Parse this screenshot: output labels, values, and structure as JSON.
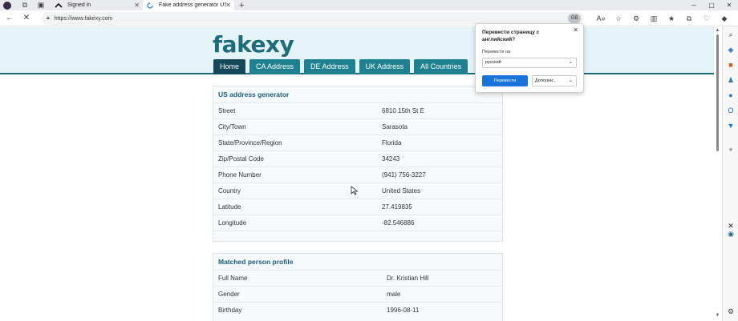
{
  "browser": {
    "tabs": [
      {
        "title": "Signed in",
        "active": false
      },
      {
        "title": "Fake address generator US - Ra",
        "active": true
      }
    ],
    "new_tab_label": "+",
    "url": "https://www.fakexy.com",
    "translate_badge": "GB",
    "icons": [
      "profile-icon",
      "workspaces-icon",
      "tab-actions-icon",
      "back-icon",
      "stop-icon",
      "read-aloud-icon",
      "favorite-icon",
      "extensions-icon",
      "split-screen-icon",
      "favorites-icon",
      "collections-icon",
      "browser-essentials-icon",
      "copilot-icon"
    ]
  },
  "page": {
    "logo": "fakexy",
    "nav": [
      "Home",
      "CA Address",
      "DE Address",
      "UK Address",
      "All Countries"
    ],
    "address_card": {
      "title": "US address generator",
      "rows": [
        {
          "k": "Street",
          "v": "6810 15th St E"
        },
        {
          "k": "City/Town",
          "v": "Sarasota"
        },
        {
          "k": "State/Province/Region",
          "v": "Florida"
        },
        {
          "k": "Zip/Postal Code",
          "v": "34243"
        },
        {
          "k": "Phone Number",
          "v": "(941) 756-3227"
        },
        {
          "k": "Country",
          "v": "United States"
        },
        {
          "k": "Latitude",
          "v": "27.419835"
        },
        {
          "k": "Longitude",
          "v": "-82.546886"
        }
      ]
    },
    "person_card": {
      "title": "Matched person profile",
      "rows": [
        {
          "k": "Full Name",
          "v": "Dr. Kristian Hill"
        },
        {
          "k": "Gender",
          "v": "male"
        },
        {
          "k": "Birthday",
          "v": "1996-08-11"
        }
      ]
    }
  },
  "translate_popup": {
    "title": "Перевести страницу с английский?",
    "target_label": "Перевести на",
    "target_value": "русский",
    "translate_button": "Перевести",
    "more_button": "Дополни..."
  },
  "colors": {
    "brand": "#1f6b7c",
    "nav_tab": "#1f8090",
    "nav_tab_active": "#15495a",
    "header_band": "#e3f3f7",
    "primary_button": "#1a73d9"
  }
}
